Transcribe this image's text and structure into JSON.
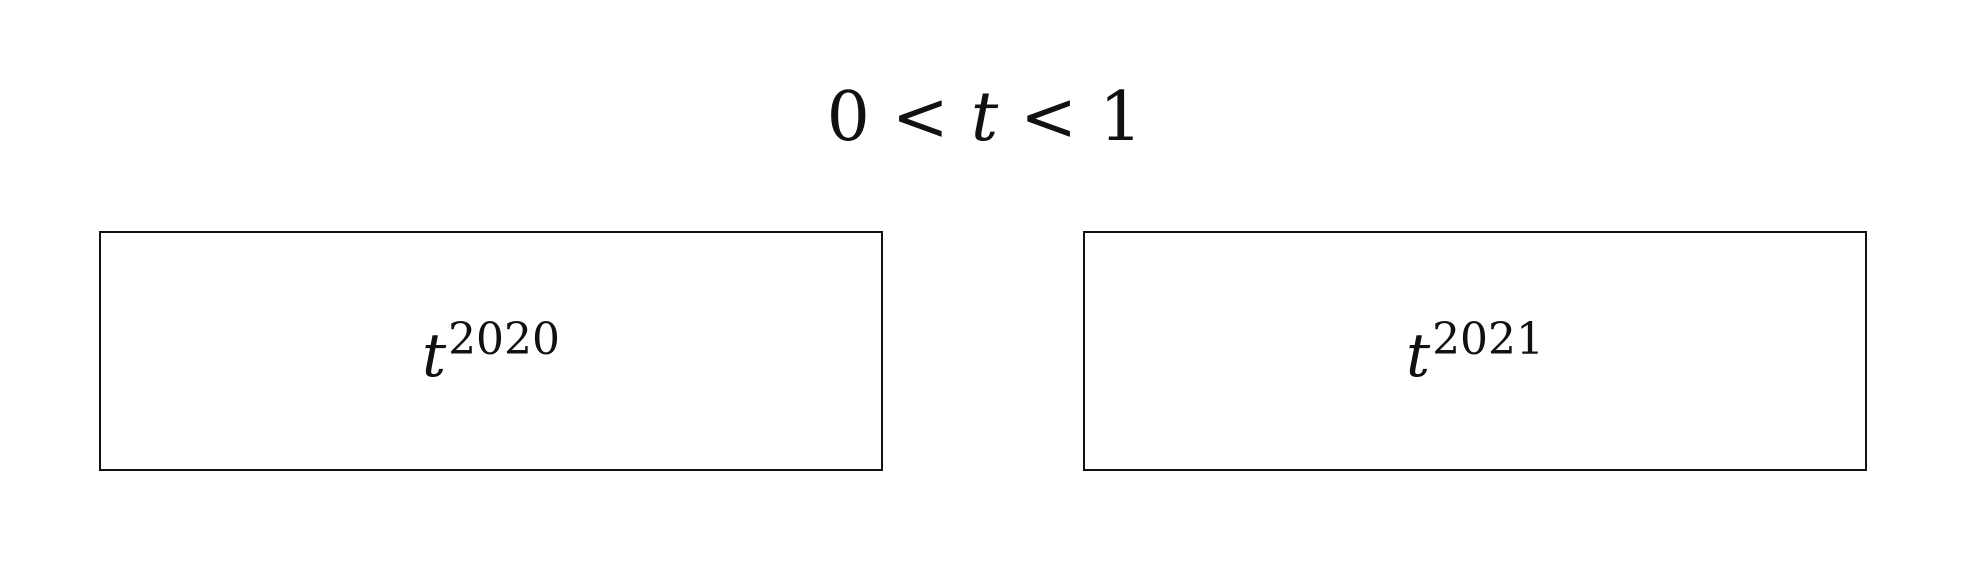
{
  "condition": {
    "lower": "0",
    "variable": "t",
    "upper": "1",
    "relation": "<"
  },
  "options": [
    {
      "base": "t",
      "exponent": "2020"
    },
    {
      "base": "t",
      "exponent": "2021"
    }
  ]
}
